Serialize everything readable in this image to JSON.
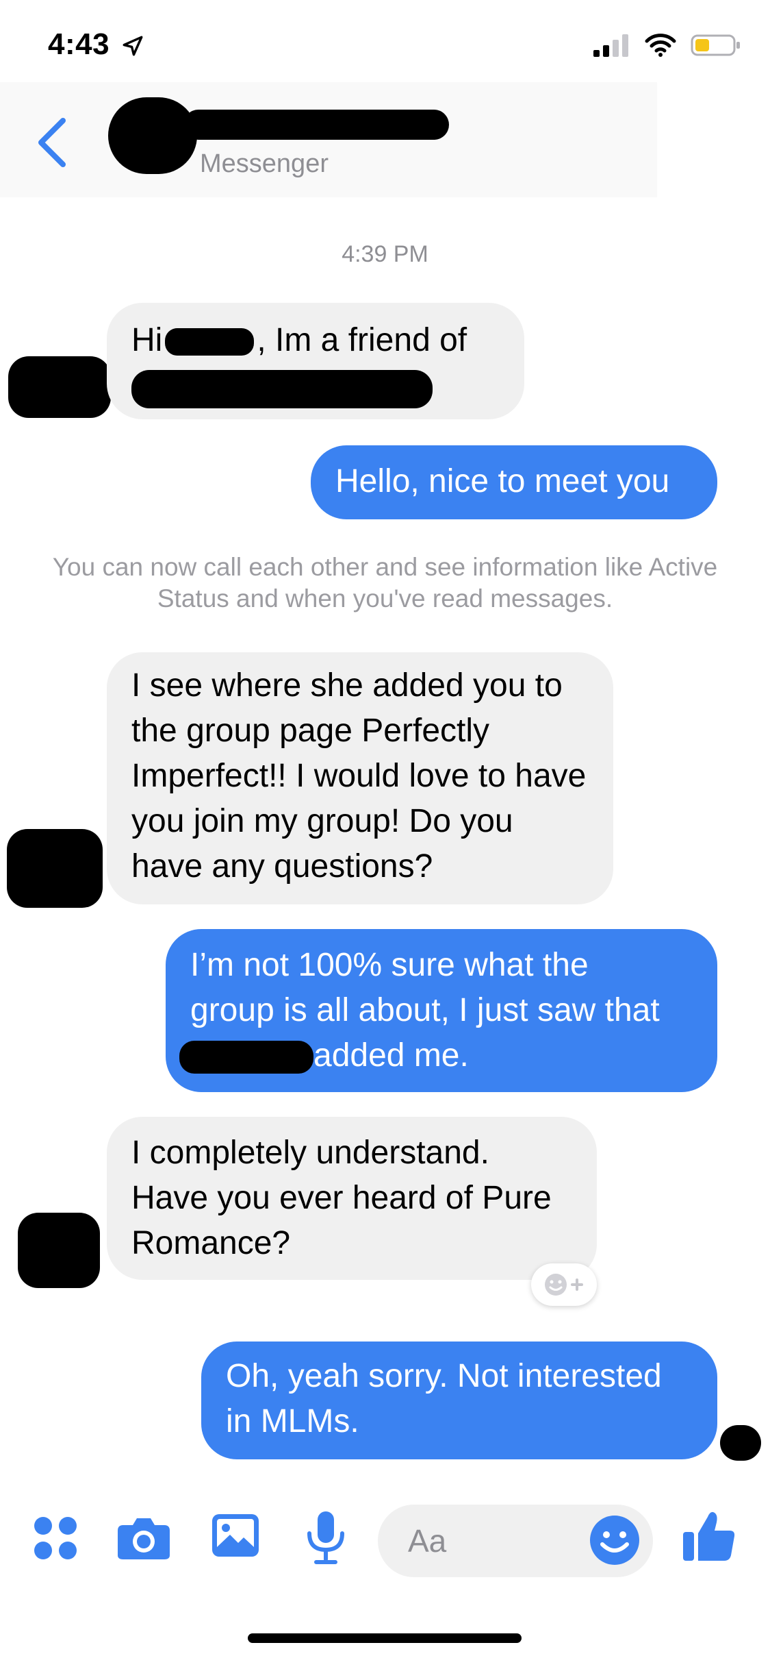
{
  "status_bar": {
    "time": "4:43"
  },
  "header": {
    "subtitle": "Messenger"
  },
  "chat": {
    "timestamp": "4:39 PM",
    "messages": [
      {
        "from": "them",
        "text_start": "Hi",
        "text_end": ", Im a friend of"
      },
      {
        "from": "me",
        "text": "Hello, nice to meet you"
      },
      {
        "from": "system",
        "text": "You can now call each other and see information like Active Status and when you've read messages."
      },
      {
        "from": "them",
        "text": "I see where she added you to the group page Perfectly Imperfect!! I would love to have you join my group! Do you have any questions?"
      },
      {
        "from": "me",
        "line1": "I’m not 100% sure what the",
        "line2": "group is all about, I just saw that",
        "line3": "added me."
      },
      {
        "from": "them",
        "text": "I completely understand. Have you ever heard of Pure Romance?"
      },
      {
        "from": "me",
        "text": "Oh, yeah sorry. Not interested in MLMs."
      }
    ]
  },
  "composer": {
    "placeholder": "Aa"
  },
  "colors": {
    "accent": "#3b82f1",
    "received_bubble": "#f0f0f0"
  }
}
